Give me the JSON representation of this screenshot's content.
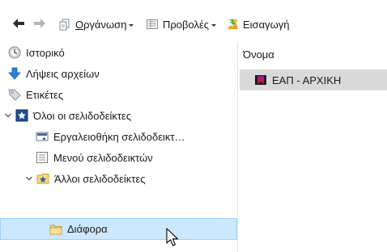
{
  "toolbar": {
    "back_icon": "back-arrow-icon",
    "forward_icon": "forward-arrow-icon",
    "organize_label": "Οργάνωση",
    "views_label": "Προβολές",
    "import_label": "Εισαγωγή"
  },
  "tree": {
    "items": [
      {
        "label": "Ιστορικό",
        "icon": "clock-icon"
      },
      {
        "label": "Λήψεις αρχείων",
        "icon": "download-arrow-icon"
      },
      {
        "label": "Ετικέτες",
        "icon": "tag-icon"
      },
      {
        "label": "Όλοι οι σελιδοδείκτες",
        "icon": "bookmarks-star-icon",
        "expanded": true
      },
      {
        "label": "Εργαλειοθήκη σελιδοδεικτ…",
        "icon": "toolbar-icon"
      },
      {
        "label": "Μενού σελιδοδεικτών",
        "icon": "menu-icon"
      },
      {
        "label": "Άλλοι σελιδοδείκτες",
        "icon": "folder-star-icon",
        "expanded": true
      },
      {
        "label": "Διάφορα",
        "icon": "folder-icon",
        "selected": true
      }
    ]
  },
  "list": {
    "column_name": "Όνομα",
    "rows": [
      {
        "label": "ΕΑΠ - ΑΡΧΙΚΗ",
        "icon": "site-bookmark-icon"
      }
    ]
  },
  "colors": {
    "selection_bg": "#cce8ff",
    "selection_border": "#99d1ff",
    "list_row_bg": "#d9d9d9",
    "folder_yellow": "#f8d775"
  }
}
